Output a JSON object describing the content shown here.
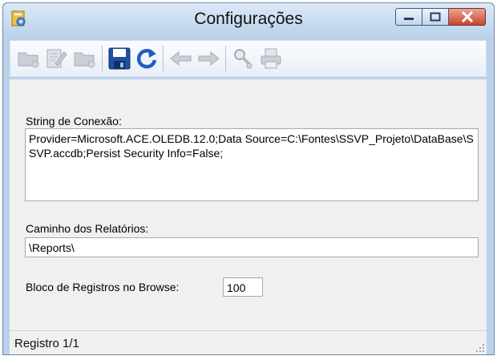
{
  "window": {
    "title": "Configurações"
  },
  "toolbar": {
    "buttons": [
      {
        "icon": "folder-new-icon",
        "enabled": false
      },
      {
        "icon": "edit-icon",
        "enabled": false
      },
      {
        "icon": "folder-delete-icon",
        "enabled": false
      },
      {
        "icon": "save-icon",
        "enabled": true
      },
      {
        "icon": "refresh-icon",
        "enabled": true
      },
      {
        "icon": "arrow-left-icon",
        "enabled": false
      },
      {
        "icon": "arrow-right-icon",
        "enabled": false
      },
      {
        "icon": "search-icon",
        "enabled": false
      },
      {
        "icon": "printer-icon",
        "enabled": false
      }
    ]
  },
  "form": {
    "connection_label": "String de Conexão:",
    "connection_value": "Provider=Microsoft.ACE.OLEDB.12.0;Data Source=C:\\Fontes\\SSVP_Projeto\\DataBase\\SSVP.accdb;Persist Security Info=False;",
    "reports_label": "Caminho dos Relatórios:",
    "reports_value": "\\Reports\\",
    "block_label": "Bloco de Registros no Browse:",
    "block_value": "100"
  },
  "status": {
    "text": "Registro 1/1"
  },
  "colors": {
    "accent": "#1f5fbf",
    "close": "#c9452f",
    "frame": "#b9d1ea"
  }
}
